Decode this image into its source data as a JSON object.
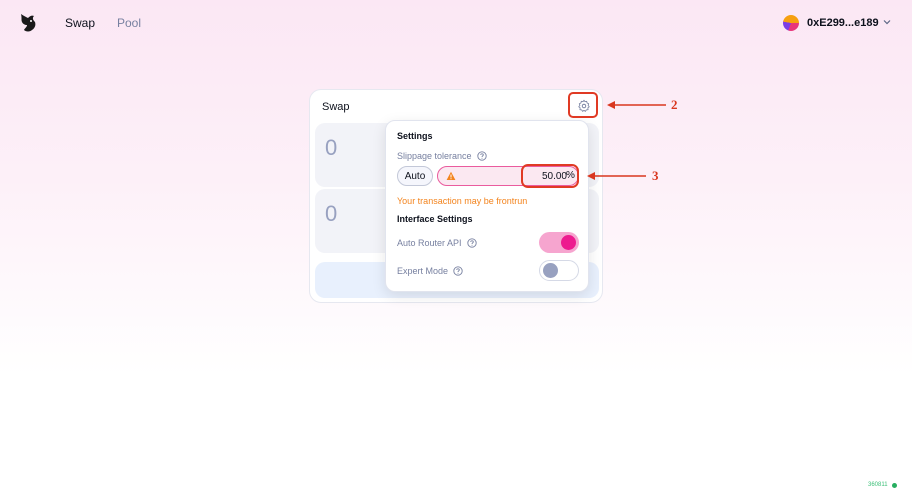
{
  "header": {
    "nav": {
      "swap_label": "Swap",
      "pool_label": "Pool"
    },
    "wallet": {
      "address": "0xE299...e189"
    }
  },
  "swap_card": {
    "title": "Swap",
    "input_amount": "0",
    "output_amount": "0"
  },
  "settings": {
    "title": "Settings",
    "slippage_label": "Slippage tolerance",
    "auto_label": "Auto",
    "slippage_value": "50.00",
    "percent_sign": "%",
    "warning_text": "Your transaction may be frontrun",
    "interface_title": "Interface Settings",
    "auto_router_label": "Auto Router API",
    "auto_router_enabled": true,
    "expert_mode_label": "Expert Mode",
    "expert_mode_enabled": false
  },
  "annotations": {
    "label_2": "2",
    "label_3": "3"
  },
  "footer": {
    "block_number": "360811"
  },
  "colors": {
    "accent_pink": "#ed1b8f",
    "warning_orange": "#f3841e",
    "annotation_red": "#e03a24",
    "status_green": "#27ae60"
  },
  "icons": [
    "uniswap-logo",
    "chevron-down-icon",
    "gear-icon",
    "help-icon",
    "warning-icon"
  ]
}
